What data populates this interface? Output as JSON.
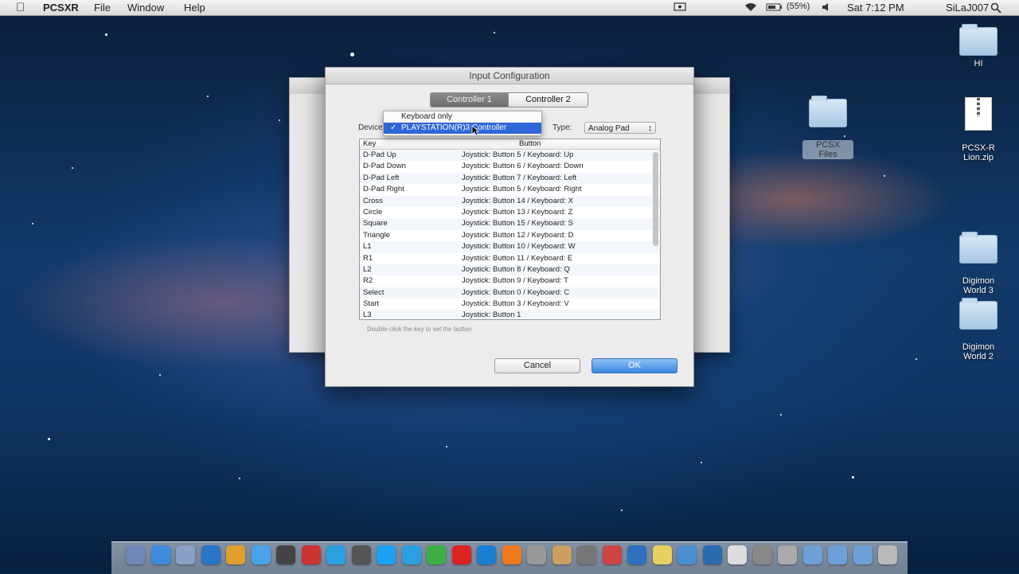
{
  "menubar": {
    "app_name": "PCSXR",
    "menus": [
      "File",
      "Window",
      "Help"
    ],
    "battery": "(55%)",
    "clock": "Sat 7:12 PM",
    "user": "SiLaJ007"
  },
  "desktop_icons": [
    {
      "label": "HI"
    },
    {
      "label": "PCSX-R\nLion.zip"
    },
    {
      "label": "PCSX\nFiles"
    },
    {
      "label": "Digimon\nWorld 3"
    },
    {
      "label": "Digimon\nWorld 2"
    }
  ],
  "dialog": {
    "title": "Input Configuration",
    "tabs": [
      "Controller 1",
      "Controller 2"
    ],
    "device_label": "Device:",
    "device_options": [
      "Keyboard only",
      "PLAYSTATION(R)3 Controller"
    ],
    "type_label": "Type:",
    "type_value": "Analog Pad",
    "columns": [
      "Key",
      "Button"
    ],
    "rows": [
      {
        "key": "D-Pad Up",
        "button": "Joystick: Button 5 / Keyboard: Up"
      },
      {
        "key": "D-Pad Down",
        "button": "Joystick: Button 6 / Keyboard: Down"
      },
      {
        "key": "D-Pad Left",
        "button": "Joystick: Button 7 / Keyboard: Left"
      },
      {
        "key": "D-Pad Right",
        "button": "Joystick: Button 5 / Keyboard: Right"
      },
      {
        "key": "Cross",
        "button": "Joystick: Button 14 / Keyboard: X"
      },
      {
        "key": "Circle",
        "button": "Joystick: Button 13 / Keyboard: Z"
      },
      {
        "key": "Square",
        "button": "Joystick: Button 15 / Keyboard: S"
      },
      {
        "key": "Triangle",
        "button": "Joystick: Button 12 / Keyboard: D"
      },
      {
        "key": "L1",
        "button": "Joystick: Button 10 / Keyboard: W"
      },
      {
        "key": "R1",
        "button": "Joystick: Button 11 / Keyboard: E"
      },
      {
        "key": "L2",
        "button": "Joystick: Button 8 / Keyboard: Q"
      },
      {
        "key": "R2",
        "button": "Joystick: Button 9 / Keyboard: T"
      },
      {
        "key": "Select",
        "button": "Joystick: Button 0 / Keyboard: C"
      },
      {
        "key": "Start",
        "button": "Joystick: Button 3 / Keyboard: V"
      },
      {
        "key": "L3",
        "button": "Joystick: Button 1"
      }
    ],
    "hint": "Double-click the key to set the button",
    "cancel_label": "Cancel",
    "ok_label": "OK"
  },
  "colors": {
    "ok_button": "#3a88e0",
    "selection": "#2f67d8"
  }
}
